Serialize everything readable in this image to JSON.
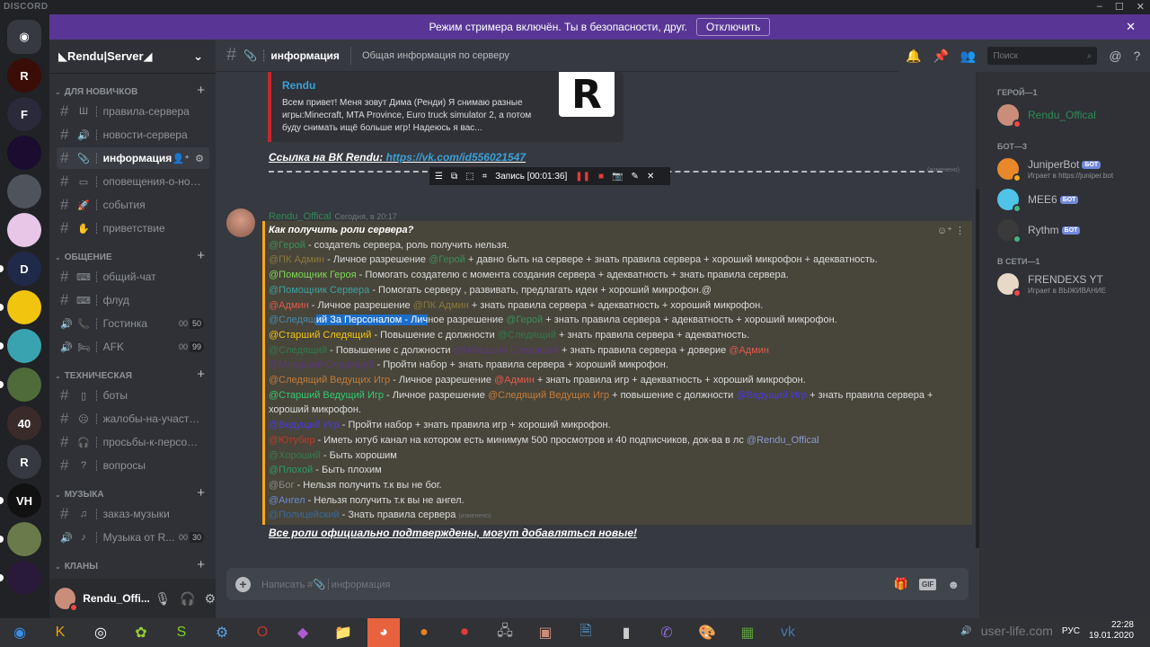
{
  "app": {
    "brand": "DISCORD",
    "window_controls": [
      "–",
      "☐",
      "✕"
    ]
  },
  "streamer_banner": {
    "text": "Режим стримера включён. Ты в безопасности, друг.",
    "button": "Отключить",
    "close": "✕",
    "color": "#593695"
  },
  "guilds": [
    {
      "label": "discord-home",
      "initial": "",
      "color": "#36393f"
    },
    {
      "label": "R",
      "initial": "R",
      "color": "#3a0d06"
    },
    {
      "label": "FGH",
      "initial": "F",
      "color": "#2a2a3a"
    },
    {
      "label": "dark",
      "initial": "",
      "color": "#1a0d30"
    },
    {
      "label": "bot-cat",
      "initial": "",
      "color": "#4f545c"
    },
    {
      "label": "girl",
      "initial": "",
      "color": "#e7c6e8"
    },
    {
      "label": "discord-like-server",
      "initial": "D",
      "color": "#1f2a4a"
    },
    {
      "label": "shield",
      "initial": "",
      "color": "#f1c40f"
    },
    {
      "label": "hh",
      "initial": "",
      "color": "#3aa3b0"
    },
    {
      "label": "landscape",
      "initial": "",
      "color": "#4f6b3a"
    },
    {
      "label": "40",
      "initial": "40",
      "color": "#3a2a2a"
    },
    {
      "label": "R-server",
      "initial": "R",
      "color": "#36393f"
    },
    {
      "label": "VimeHub",
      "initial": "VH",
      "color": "#111111"
    },
    {
      "label": "minecraft",
      "initial": "",
      "color": "#6b7a4a"
    },
    {
      "label": "night",
      "initial": "",
      "color": "#2a1a3a"
    }
  ],
  "server": {
    "name": "◣Rendu|Server◢",
    "dropdown": "⌄"
  },
  "categories": [
    {
      "name": "ДЛЯ НОВИЧКОВ",
      "channels": [
        {
          "type": "text",
          "emoji": "Ш",
          "name": "правила-сервера"
        },
        {
          "type": "text",
          "emoji": "🔊",
          "name": "новости-сервера"
        },
        {
          "type": "text",
          "emoji": "📎",
          "name": "информация",
          "active": true
        },
        {
          "type": "text",
          "emoji": "▭",
          "name": "оповещения-о-нов..."
        },
        {
          "type": "text",
          "emoji": "🚀",
          "name": "события"
        },
        {
          "type": "text",
          "emoji": "✋",
          "name": "приветствие"
        }
      ]
    },
    {
      "name": "ОБЩЕНИЕ",
      "channels": [
        {
          "type": "text",
          "emoji": "⌨",
          "name": "общий-чат"
        },
        {
          "type": "text",
          "emoji": "⌨",
          "name": "флуд"
        },
        {
          "type": "voice",
          "emoji": "📞",
          "name": "Гостинка",
          "count_a": "00",
          "count_b": "50"
        },
        {
          "type": "voice",
          "emoji": "🛏",
          "name": "AFK",
          "count_a": "00",
          "count_b": "99"
        }
      ]
    },
    {
      "name": "ТЕХНИЧЕСКАЯ",
      "channels": [
        {
          "type": "text",
          "emoji": "▯",
          "name": "боты"
        },
        {
          "type": "text",
          "emoji": "☹",
          "name": "жалобы-на-участн..."
        },
        {
          "type": "text",
          "emoji": "🎧",
          "name": "просьбы-к-персона..."
        },
        {
          "type": "text",
          "emoji": "?",
          "name": "вопросы"
        }
      ]
    },
    {
      "name": "МУЗЫКА",
      "channels": [
        {
          "type": "text",
          "emoji": "♫",
          "name": "заказ-музыки"
        },
        {
          "type": "voice",
          "emoji": "♪",
          "name": "Музыка от R...",
          "count_a": "00",
          "count_b": "30"
        }
      ]
    },
    {
      "name": "КЛАНЫ",
      "channels": []
    }
  ],
  "user_panel": {
    "name": "Rendu_Offi...",
    "status_color": "#f04747"
  },
  "channel_header": {
    "title": "информация",
    "topic": "Общая информация по серверу",
    "search_placeholder": "Поиск"
  },
  "embed": {
    "author": "Rendu",
    "description": "Всем привет! Меня зовут Дима (Ренди) Я снимаю разные игры:Minecraft, MTA Province, Euro truck simulator 2, а потом буду снимать ищё больше игр! Надеюсь я вас...",
    "thumb": "R",
    "border_color": "#c4282b"
  },
  "vk_line": {
    "label": "Ссылка на ВК Rendu:",
    "url": "https://vk.com/id556021547"
  },
  "edited_label": "(изменено)",
  "recorder": {
    "label": "Запись [00:01:36]"
  },
  "message": {
    "author": "Rendu_Offical",
    "timestamp": "Сегодня, в 20:17",
    "author_color": "#2e8b57",
    "question": "Как получить роли сервера?",
    "lines": [
      {
        "role": "@Герой",
        "color": "#3a8f5a",
        "text": " - создатель сервера, роль получить нельзя."
      },
      {
        "role": "@ПК Админ",
        "color": "#8a7a3a",
        "text": " - Личное разрешение ",
        "role2": "@Герой",
        "color2": "#3a8f5a",
        "text2": " + давно быть на  сервере + знать правила сервера + хороший микрофон + адекватность."
      },
      {
        "role": "@Помощник Героя",
        "color": "#7ed957",
        "text": " - Помогать создателю  с момента создания сервера + адекватность + знать правила сервера."
      },
      {
        "role": "@Помощник Сервера",
        "color": "#3aa3a0",
        "text": " - Помогать серверу , развивать, предлагать идеи + хороший микрофон.@"
      },
      {
        "role": "@Админ",
        "color": "#e05b4b",
        "text": " - Личное разрешение ",
        "role2": "@ПК Админ",
        "color2": "#8a7a3a",
        "text2": " + знать правила сервера + адекватность + хороший микрофон."
      },
      {
        "role": "@Следящ",
        "color": "#4a8ab0",
        "selected": "ий За Персоналом - Лич",
        "text": "ное разрешение ",
        "role2": "@Герой",
        "color2": "#3a8f5a",
        "text2": " + знать правила сервера + адекватность + хороший микрофон."
      },
      {
        "role": "@Старший Следящий",
        "color": "#f1c40f",
        "text": " - Повышение с должности ",
        "role2": "@Следящий",
        "color2": "#2f7a4a",
        "text2": "  + знать правила сервера + адекватность."
      },
      {
        "role": "@Следящий",
        "color": "#2f7a4a",
        "text": " - Повышение с должности ",
        "role2": "@Младший Следящий",
        "color2": "#5a3a7a",
        "text2": " + знать правила сервера + доверие ",
        "role3": "@Админ",
        "color3": "#e05b4b"
      },
      {
        "role": "@Младший Следящий",
        "color": "#5a3a7a",
        "text": " - Пройти набор + знать правила сервера + хороший микрофон."
      },
      {
        "role": "@Следящий Ведущих Игр",
        "color": "#c27c3a",
        "text": " - Личное разрешение ",
        "role2": "@Админ",
        "color2": "#e05b4b",
        "text2": " + знать правила игр + адекватность + хороший микрофон."
      },
      {
        "role": "@Старший Ведущий Игр",
        "color": "#2ecc71",
        "text": " - Личное разрешение ",
        "role2": "@Следящий Ведущих Игр",
        "color2": "#c27c3a",
        "text2": " + повышение с должности ",
        "role3": "@Ведущий Игр",
        "color3": "#4a3adf",
        "text3": " + знать правила сервера + хороший микрофон.",
        "wrap": true
      },
      {
        "role": "@Ведущий Игр",
        "color": "#4a3adf",
        "text": " - Пройти набор + знать правила игр + хороший микрофон."
      },
      {
        "role": "@Ютубер",
        "color": "#c0392b",
        "text": " - Иметь ютуб канал на котором есть минимум 500 просмотров и 40 подписчиков, док-ва в лс ",
        "role2": "@Rendu_Offical",
        "color2": "#8b9ad6"
      },
      {
        "role": "@Хороший",
        "color": "#3a7a4a",
        "text": " - Быть хорошим"
      },
      {
        "role": "@Плохой",
        "color": "#2e9a6a",
        "text": " - Быть плохим"
      },
      {
        "role": "@Бог",
        "color": "#8a8a8a",
        "text": " - Нельзя получить т.к вы не бог."
      },
      {
        "role": "@Ангел",
        "color": "#6a8ad6",
        "text": " - Нельзя получить т.к вы не ангел."
      },
      {
        "role": "@Полицейский",
        "color": "#3a6a9a",
        "text": " - Знать правила сервера",
        "edited": "(изменено)"
      }
    ],
    "highlight_color": "#faa61a",
    "footer": "Все роли официально подтверждены, могут добавляться новые!"
  },
  "composer": {
    "placeholder": "Написать #📎┊информация",
    "gif": "GIF"
  },
  "members": {
    "groups": [
      {
        "title": "ГЕРОЙ—1",
        "items": [
          {
            "name": "Rendu_Offical",
            "color": "#2e8b57",
            "avatar": "#c98d7a",
            "status": "#f04747"
          }
        ]
      },
      {
        "title": "БОТ—3",
        "items": [
          {
            "name": "JuniperBot",
            "bot": "БОТ",
            "sub": "Играет в https://juniper.bot",
            "color": "#b9bbbe",
            "avatar": "#e8882a",
            "status": "#faa61a"
          },
          {
            "name": "MEE6",
            "bot": "БОТ",
            "color": "#b9bbbe",
            "avatar": "#4fc3e8",
            "status": "#43b581"
          },
          {
            "name": "Rythm",
            "bot": "БОТ",
            "color": "#b9bbbe",
            "avatar": "#3a3a3a",
            "status": "#43b581"
          }
        ]
      },
      {
        "title": "В СЕТИ—1",
        "items": [
          {
            "name": "FRENDEXS YT",
            "sub": "Играет в ВЫЖИВАНИЕ",
            "color": "#b9bbbe",
            "avatar": "#e8d8c8",
            "status": "#f04747"
          }
        ]
      }
    ]
  },
  "taskbar": {
    "apps": [
      "start",
      "k-app",
      "obs",
      "game",
      "s-app",
      "steam",
      "opera",
      "gem",
      "folder",
      "discord",
      "paint3d",
      "recorder",
      "network",
      "photo",
      "notepad",
      "cmd",
      "viber",
      "paint",
      "minecraft",
      "vk"
    ],
    "active": "discord",
    "lang": "РУС",
    "time": "22:28",
    "date": "19.01.2020",
    "watermark": "user-life.com"
  }
}
